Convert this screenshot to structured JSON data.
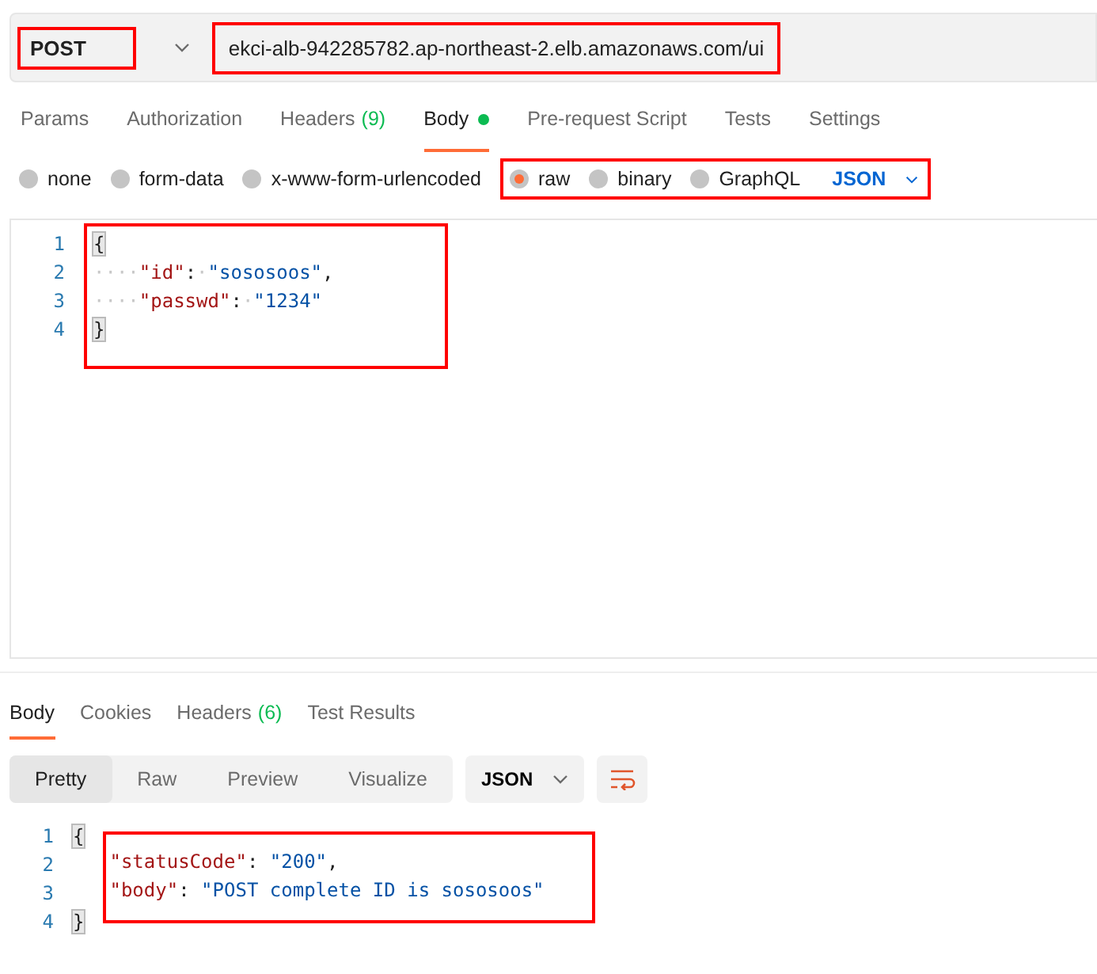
{
  "request": {
    "method": {
      "text": "POST",
      "highlighted": true
    },
    "url": {
      "value": "ekci-alb-942285782.ap-northeast-2.elb.amazonaws.com/ui",
      "highlighted": true
    }
  },
  "request_tabs": [
    {
      "label": "Params",
      "selected": false
    },
    {
      "label": "Authorization",
      "selected": false
    },
    {
      "label": "Headers",
      "count": "(9)",
      "selected": false
    },
    {
      "label": "Body",
      "dot": true,
      "selected": true
    },
    {
      "label": "Pre-request Script",
      "selected": false
    },
    {
      "label": "Tests",
      "selected": false
    },
    {
      "label": "Settings",
      "selected": false
    }
  ],
  "body_types": {
    "highlighted": true,
    "options": [
      {
        "label": "none",
        "selected": false
      },
      {
        "label": "form-data",
        "selected": false
      },
      {
        "label": "x-www-form-urlencoded",
        "selected": false
      },
      {
        "label": "raw",
        "selected": true
      },
      {
        "label": "binary",
        "selected": false
      },
      {
        "label": "GraphQL",
        "selected": false
      }
    ],
    "format": "JSON"
  },
  "request_body": {
    "highlighted": true,
    "lines": [
      {
        "number": "1",
        "tokens": [
          {
            "kind": "bracket",
            "text": "{"
          }
        ]
      },
      {
        "number": "2",
        "tokens": [
          {
            "kind": "ws",
            "text": "····"
          },
          {
            "kind": "key",
            "text": "\"id\""
          },
          {
            "kind": "punct",
            "text": ":"
          },
          {
            "kind": "ws",
            "text": "·"
          },
          {
            "kind": "string",
            "text": "\"sososoos\""
          },
          {
            "kind": "punct",
            "text": ","
          }
        ]
      },
      {
        "number": "3",
        "tokens": [
          {
            "kind": "ws",
            "text": "····"
          },
          {
            "kind": "key",
            "text": "\"passwd\""
          },
          {
            "kind": "punct",
            "text": ":"
          },
          {
            "kind": "ws",
            "text": "·"
          },
          {
            "kind": "string",
            "text": "\"1234\""
          }
        ]
      },
      {
        "number": "4",
        "tokens": [
          {
            "kind": "bracket",
            "text": "}"
          }
        ]
      }
    ]
  },
  "response_tabs": [
    {
      "label": "Body",
      "selected": true
    },
    {
      "label": "Cookies",
      "selected": false
    },
    {
      "label": "Headers",
      "count": "(6)",
      "selected": false
    },
    {
      "label": "Test Results",
      "selected": false
    }
  ],
  "view_modes": [
    {
      "label": "Pretty",
      "selected": true
    },
    {
      "label": "Raw",
      "selected": false
    },
    {
      "label": "Preview",
      "selected": false
    },
    {
      "label": "Visualize",
      "selected": false
    }
  ],
  "response_format": "JSON",
  "response_body": {
    "highlighted": true,
    "lines": [
      {
        "number": "1",
        "tokens": [
          {
            "kind": "bracket",
            "text": "{"
          }
        ]
      },
      {
        "number": "2",
        "tokens": [
          {
            "kind": "key",
            "text": "\"statusCode\""
          },
          {
            "kind": "punct",
            "text": ": "
          },
          {
            "kind": "string",
            "text": "\"200\""
          },
          {
            "kind": "punct",
            "text": ","
          }
        ]
      },
      {
        "number": "3",
        "tokens": [
          {
            "kind": "key",
            "text": "\"body\""
          },
          {
            "kind": "punct",
            "text": ": "
          },
          {
            "kind": "string",
            "text": "\"POST complete ID is sososoos\""
          }
        ]
      },
      {
        "number": "4",
        "tokens": [
          {
            "kind": "bracket",
            "text": "}"
          }
        ]
      }
    ]
  }
}
